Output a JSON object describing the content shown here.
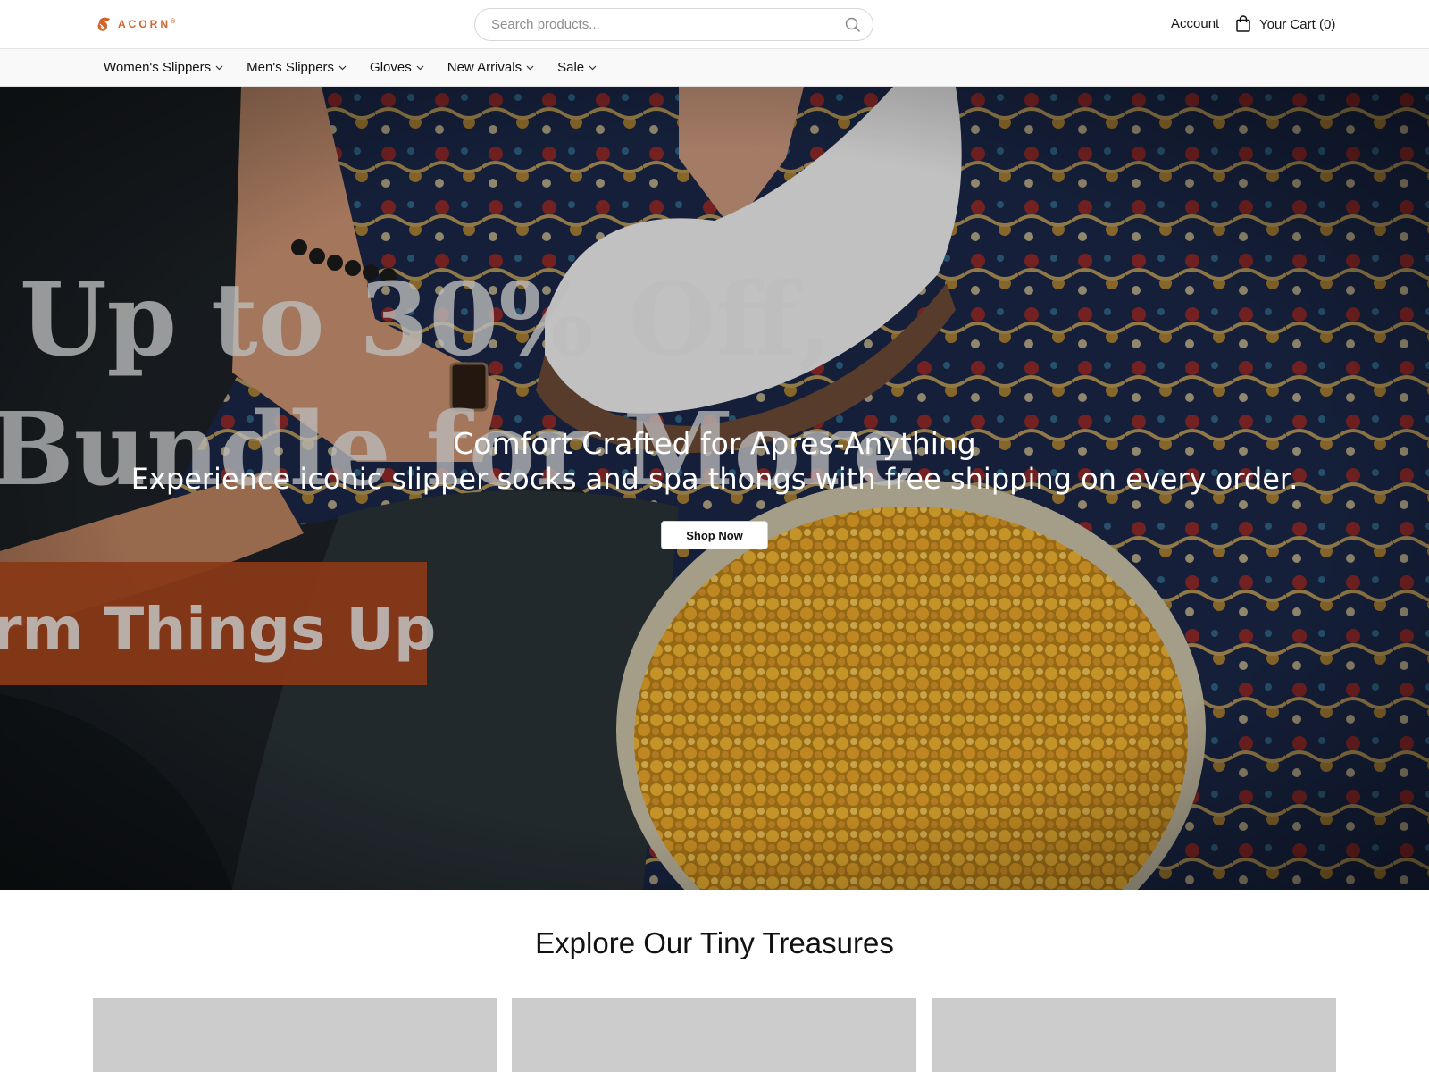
{
  "header": {
    "logo_text": "ACORN",
    "logo_mark": "®",
    "search_placeholder": "Search products...",
    "account_label": "Account",
    "cart_label": "Your Cart (0)"
  },
  "nav": {
    "items": [
      {
        "label": "Women's Slippers"
      },
      {
        "label": "Men's Slippers"
      },
      {
        "label": "Gloves"
      },
      {
        "label": "New Arrivals"
      },
      {
        "label": "Sale"
      }
    ]
  },
  "hero": {
    "title": "Comfort Crafted for Apres-Anything",
    "subtitle": "Experience iconic slipper socks and spa thongs with free shipping on every order.",
    "cta_label": "Shop Now",
    "image_text_line1": "Up to 30% Off,",
    "image_text_line2": "Bundle for More",
    "image_banner_text": "rm Things Up"
  },
  "section": {
    "title": "Explore Our Tiny Treasures"
  },
  "colors": {
    "brand": "#d3652b",
    "banner": "#a5471c",
    "card_placeholder": "#cccccc"
  }
}
